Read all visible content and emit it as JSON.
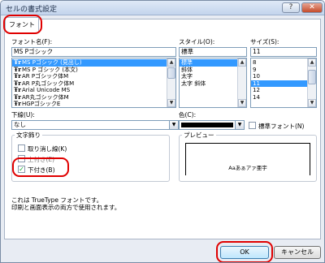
{
  "window": {
    "title": "セルの書式設定",
    "help": "?",
    "close": "✕"
  },
  "tab": {
    "label": "フォント"
  },
  "font_name": {
    "label": "フォント名(F):",
    "value": "MS Pゴシック",
    "items": [
      "MS Pゴシック (見出し)",
      "MS P ゴシック (本文)",
      "AR Pゴシック体M",
      "AR P丸ゴシック体M",
      "Arial Unicode MS",
      "AR丸ゴシック体M",
      "HGPゴシックE"
    ],
    "tt_glyph": "Ŧr"
  },
  "style": {
    "label": "スタイル(O):",
    "value": "標準",
    "items": [
      "標準",
      "斜体",
      "太字",
      "太字 斜体"
    ]
  },
  "size": {
    "label": "サイズ(S):",
    "value": "11",
    "items": [
      "8",
      "9",
      "10",
      "11",
      "12",
      "14"
    ]
  },
  "underline": {
    "label": "下線(U):",
    "value": "なし"
  },
  "color": {
    "label": "色(C):",
    "normal_font_label": "標準フォント(N)",
    "swatch": "#000000"
  },
  "effects": {
    "title": "文字飾り",
    "strikethrough": {
      "label": "取り消し線(K)",
      "checked": false
    },
    "superscript": {
      "label": "上付き(E)",
      "checked": false
    },
    "subscript": {
      "label": "下付き(B)",
      "checked": true
    }
  },
  "preview": {
    "title": "プレビュー",
    "sample": "Aaあぁアァ亜宇"
  },
  "info": {
    "line1": "これは TrueType フォントです。",
    "line2": "印刷と画面表示の両方で使用されます。"
  },
  "buttons": {
    "ok": "OK",
    "cancel": "キャンセル"
  },
  "check_mark": "✓",
  "scroll": {
    "up": "▲",
    "down": "▼"
  },
  "colors": {
    "highlight": "#3399ff",
    "annotation_red": "#e00000"
  }
}
